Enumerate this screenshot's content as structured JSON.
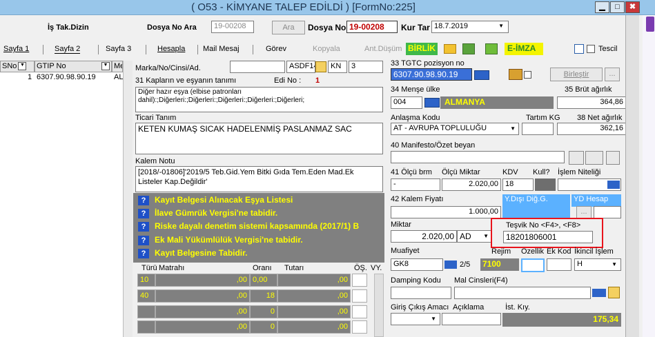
{
  "window": {
    "title": "( O53 - KİMYANE TALEP EDİLDİ ) [FormNo:225]",
    "min": "▁",
    "max": "□",
    "close": "✖"
  },
  "toolbar": {
    "is_takip": "İş Tak.Dizin",
    "dosya_no_ara_label": "Dosya No Ara",
    "dosya_no_ara_value": "19-00208",
    "ara_button": "Ara",
    "dosya_no_label": "Dosya No",
    "dosya_no_value": "19-00208",
    "kur_tar_label": "Kur Tar",
    "kur_tar_value": "18.7.2019"
  },
  "tabs": {
    "sayfa1": "Sayfa 1",
    "sayfa2": "Sayfa 2",
    "sayfa3": "Sayfa 3",
    "hesapla": "Hesapla",
    "mail": "Mail Mesaj",
    "gorev": "Görev",
    "kopyala": "Kopyala",
    "antdusum": "Ant.Düşüm",
    "birlik": "BİRLİK",
    "eimza": "E-İMZA",
    "tescil": "Tescil"
  },
  "grid": {
    "col_sno": "SNo",
    "col_gtip": "GTIP No",
    "col_me": "Me",
    "row1_sno": "1",
    "row1_gtip": "6307.90.98.90.19",
    "row1_me": "AL"
  },
  "form": {
    "marka_label": "Marka/No/Cinsi/Ad.",
    "marka_value": "",
    "asdf_value": "ASDF14",
    "kn_value": "KN",
    "kn_num": "3",
    "kaplar_label": "31 Kapların ve eşyanın tanımı",
    "edino_label": "Edi No :",
    "edino_value": "1",
    "esya_desc": "Diğer hazır eşya (elbise patronları dahil):;Diğerleri:;Diğerleri:;Diğerleri:;Diğerleri:;Diğerleri;",
    "ticari_label": "Ticari Tanım",
    "ticari_value": "KETEN KUMAŞ SICAK HADELENMİŞ PASLANMAZ SAC",
    "kalem_notu_label": "Kalem Notu",
    "kalem_notu_value": "[2018/-01806]'2019/5 Teb.Gid.Yem Bitki Gıda Tem.Eden Mad.Ek Listeler Kap.Değildir'",
    "warnings": [
      "Kayıt Belgesi Alınacak Eşya Listesi",
      "İlave Gümrük Vergisi'ne tabidir.",
      "Riske dayalı denetim sistemi kapsamında (2017/1) B",
      "Ek Mali Yükümlülük Vergisi'ne tabidir.",
      "Kayıt Belgesine Tabidir."
    ],
    "tax_headers": {
      "turu": "Türü",
      "matrahi": "Matrahı",
      "orani": "Oranı",
      "tutari": "Tutarı",
      "os": "ÖŞ.",
      "vy": "VY."
    },
    "tax_rows": [
      {
        "turu": "10",
        "matrah": ",00",
        "oran": "0,00",
        "tutar": ",00"
      },
      {
        "turu": "40",
        "matrah": ",00",
        "oran": "18",
        "tutar": ",00"
      },
      {
        "turu": "",
        "matrah": ",00",
        "oran": "0",
        "tutar": ",00"
      },
      {
        "turu": "",
        "matrah": ",00",
        "oran": "0",
        "tutar": ",00"
      }
    ],
    "tgtc_label": "33 TGTC pozisyon no",
    "tgtc_value": "6307.90.98.90.19",
    "birlestir": "Birleştir",
    "dots": "...",
    "mense_label": "34 Menşe ülke",
    "mense_code": "004",
    "mense_name": "ALMANYA",
    "brut_label": "35 Brüt ağırlık",
    "brut_value": "364,86",
    "anlasma_label": "Anlaşma Kodu",
    "anlasma_value": "AT    - AVRUPA TOPLULUĞU",
    "tartim_label": "Tartım KG",
    "net_label": "38 Net ağırlık",
    "net_value": "362,16",
    "manifesto_label": "40 Manifesto/Özet beyan",
    "olcu_label": "41 Ölçü brm",
    "olcu_miktar_label": "Ölçü Miktar",
    "kdv_label": "KDV",
    "kull_label": "Kull?",
    "islem_nit_label": "İşlem Niteliği",
    "olcu_value": "-",
    "olcu_miktar_value": "2.020,00",
    "kdv_value": "18",
    "kalem_fiyati_label": "42 Kalem Fiyatı",
    "kalem_fiyati_value": "1.000,00",
    "ydisi_label": "Y.Dışı Diğ.G.",
    "ydhesap_label": "YD Hesap",
    "miktar_label": "Miktar",
    "miktar_value": "2.020,00",
    "miktar_unit": "AD",
    "tesvik_label": "Teşvik No <F4>, <F8>",
    "tesvik_value": "18201806001",
    "muafiyet_label": "Muafiyet",
    "muafiyet_value": "GK8",
    "muaf_page": "2/5",
    "rejim_label": "Rejim",
    "rejim_value": "7100",
    "ozellik_label": "Ozellik",
    "ekkod_label": "Ek Kod",
    "ikincil_label": "İkincil İşlem",
    "ikincil_value": "H",
    "damping_label": "Damping Kodu",
    "mal_cinsleri_label": "Mal Cinsleri(F4)",
    "giris_label": "Giriş Çıkış Amacı",
    "aciklama_label": "Açıklama",
    "ist_kiy_label": "İst. Kıy.",
    "ist_kiy_value": "175,34"
  },
  "colors": {
    "title_bg": "#98c6ea",
    "gray": "#808080",
    "yellow": "#ffff00",
    "blue_sel": "#3a6fd8",
    "red_box": "#e8141c",
    "red_text": "#c00000"
  }
}
